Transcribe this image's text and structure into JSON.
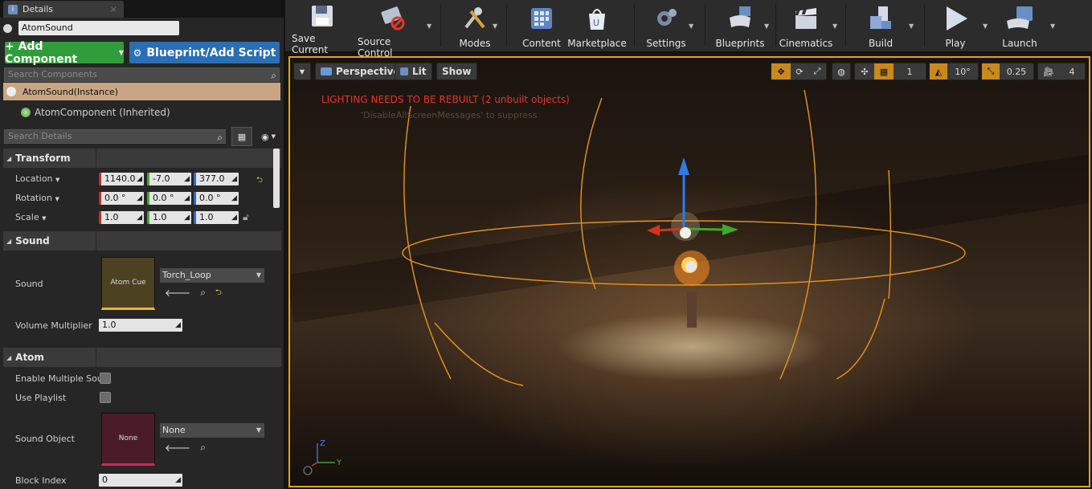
{
  "details": {
    "tab_title": "Details",
    "actor_name": "AtomSound",
    "add_component_label": "+ Add Component",
    "blueprint_label": "Blueprint/Add Script",
    "search_components_placeholder": "Search Components",
    "component_instance": "AtomSound(Instance)",
    "component_inherited": "AtomComponent (Inherited)",
    "search_details_placeholder": "Search Details",
    "categories": {
      "transform": "Transform",
      "sound": "Sound",
      "atom": "Atom"
    },
    "transform": {
      "location_label": "Location",
      "location": [
        "1140.0",
        "-7.0",
        "377.0"
      ],
      "rotation_label": "Rotation",
      "rotation": [
        "0.0 °",
        "0.0 °",
        "0.0 °"
      ],
      "scale_label": "Scale",
      "scale": [
        "1.0",
        "1.0",
        "1.0"
      ]
    },
    "sound": {
      "sound_label": "Sound",
      "thumb_text": "Atom Cue",
      "sound_value": "Torch_Loop",
      "volume_label": "Volume Multiplier",
      "volume_value": "1.0"
    },
    "atom": {
      "enable_multiple_label": "Enable Multiple Sou",
      "use_playlist_label": "Use Playlist",
      "sound_object_label": "Sound Object",
      "sound_object_thumb": "None",
      "sound_object_value": "None",
      "block_index_label": "Block Index",
      "block_index_value": "0"
    }
  },
  "toolbar": {
    "save_current": "Save Current",
    "source_control": "Source Control",
    "modes": "Modes",
    "content": "Content",
    "marketplace": "Marketplace",
    "settings": "Settings",
    "blueprints": "Blueprints",
    "cinematics": "Cinematics",
    "build": "Build",
    "play": "Play",
    "launch": "Launch"
  },
  "viewport": {
    "perspective_label": "Perspective",
    "lit_label": "Lit",
    "show_label": "Show",
    "grid_snap_value": "1",
    "rotation_snap_value": "10°",
    "scale_snap_value": "0.25",
    "camera_speed_value": "4",
    "warning": "LIGHTING NEEDS TO BE REBUILT (2 unbuilt objects)",
    "ghost_text": "'DisableAllScreenMessages' to suppress",
    "axis_z": "Z",
    "axis_y": "Y"
  },
  "colors": {
    "accent_green": "#2f9e3a",
    "accent_blue": "#2a6fb5",
    "selection_orange": "#e3a11b",
    "warning_red": "#e8332a"
  }
}
